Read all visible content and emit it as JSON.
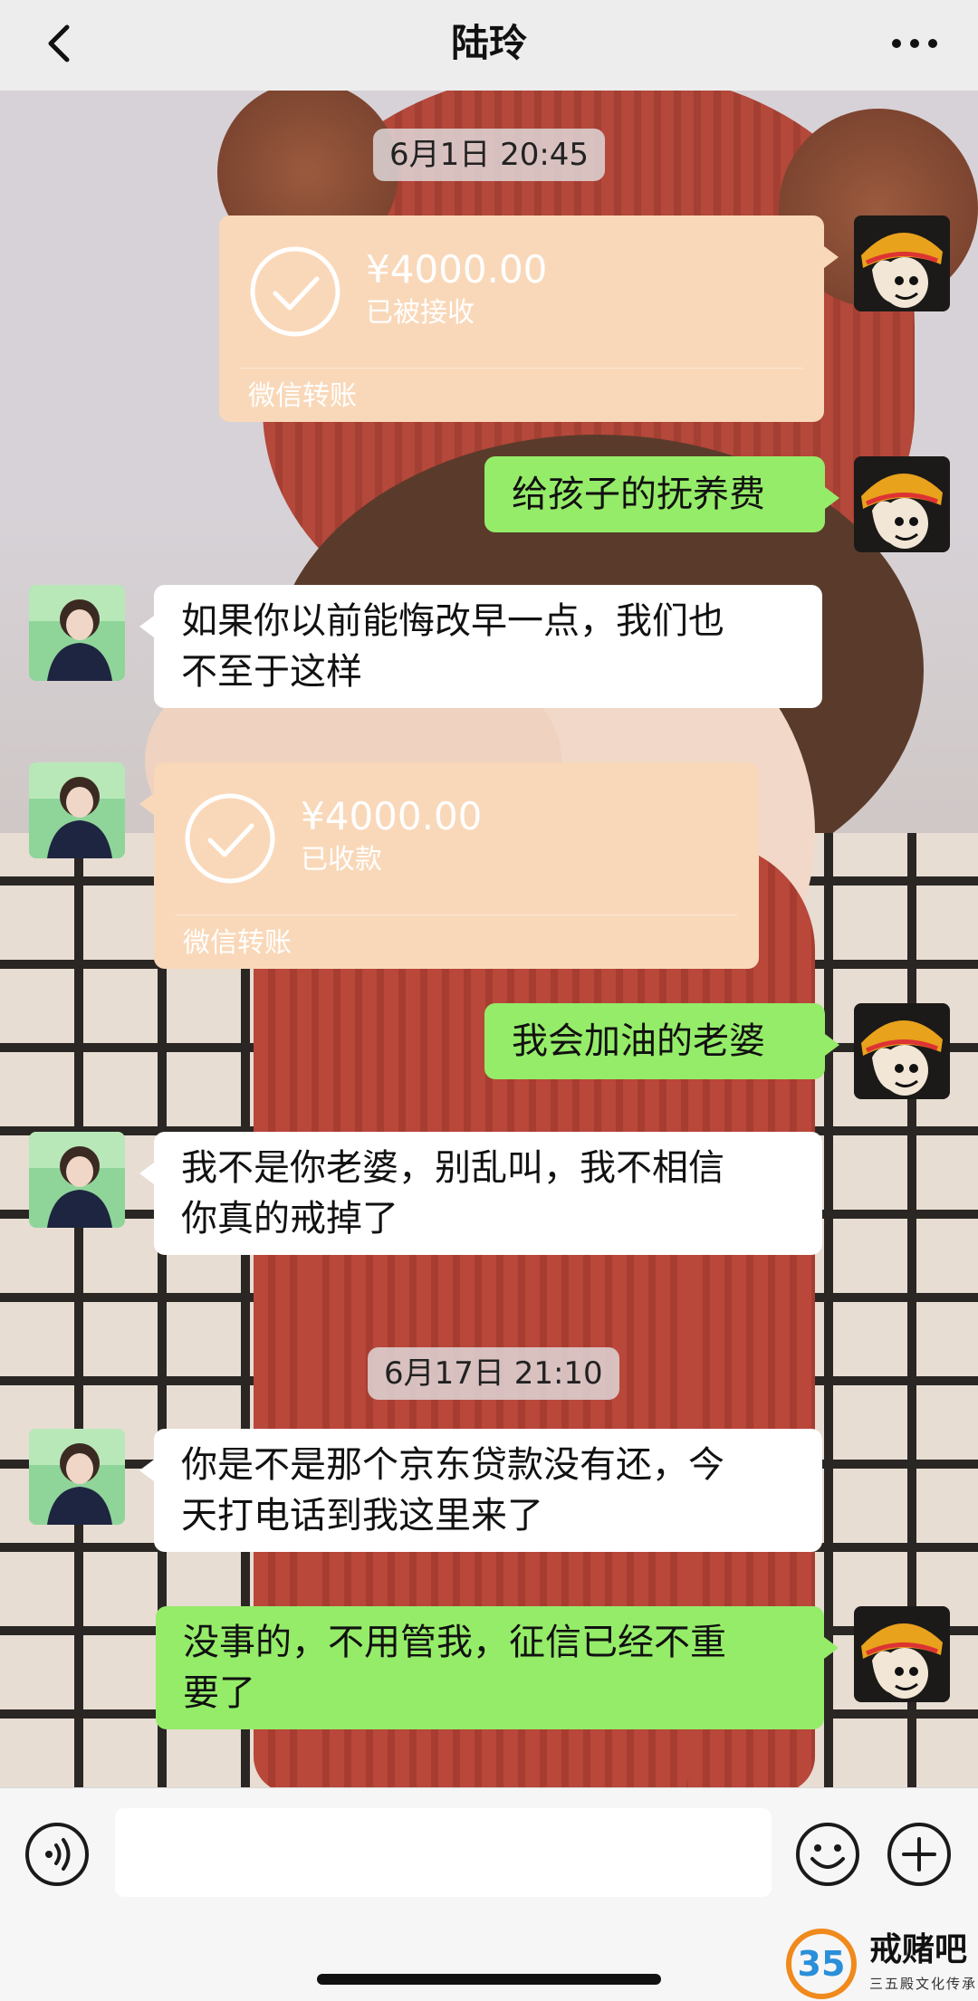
{
  "header": {
    "title": "陆玲",
    "back_icon": "chevron-left-icon",
    "more_icon": "ellipsis-icon"
  },
  "chat": {
    "timestamps": [
      "6月1日 20:45",
      "6月17日 21:10"
    ],
    "messages": [
      {
        "type": "transfer",
        "from": "me",
        "amount": "¥4000.00",
        "status": "已被接收",
        "footer": "微信转账"
      },
      {
        "type": "text",
        "from": "me",
        "text": "给孩子的抚养费"
      },
      {
        "type": "text",
        "from": "her",
        "lines": [
          "如果你以前能悔改早一点，我们也",
          "不至于这样"
        ]
      },
      {
        "type": "transfer",
        "from": "her",
        "amount": "¥4000.00",
        "status": "已收款",
        "footer": "微信转账"
      },
      {
        "type": "text",
        "from": "me",
        "text": "我会加油的老婆"
      },
      {
        "type": "text",
        "from": "her",
        "lines": [
          "我不是你老婆，别乱叫，我不相信",
          "你真的戒掉了"
        ]
      },
      {
        "type": "text",
        "from": "her",
        "lines": [
          "你是不是那个京东贷款没有还，今",
          "天打电话到我这里来了"
        ]
      },
      {
        "type": "text",
        "from": "me",
        "lines": [
          "没事的，不用管我，征信已经不重",
          "要了"
        ]
      }
    ]
  },
  "input_bar": {
    "voice_icon": "voice-icon",
    "input_value": "",
    "emoji_icon": "emoji-icon",
    "plus_icon": "plus-icon"
  },
  "watermark": {
    "logo_text": "35",
    "title": "戒赌吧",
    "subtitle": "三五殿文化传承"
  },
  "colors": {
    "sent_bubble": "#95ec69",
    "received_bubble": "#ffffff",
    "transfer_card": "#f9d8b9",
    "header_bg": "#ededed"
  }
}
